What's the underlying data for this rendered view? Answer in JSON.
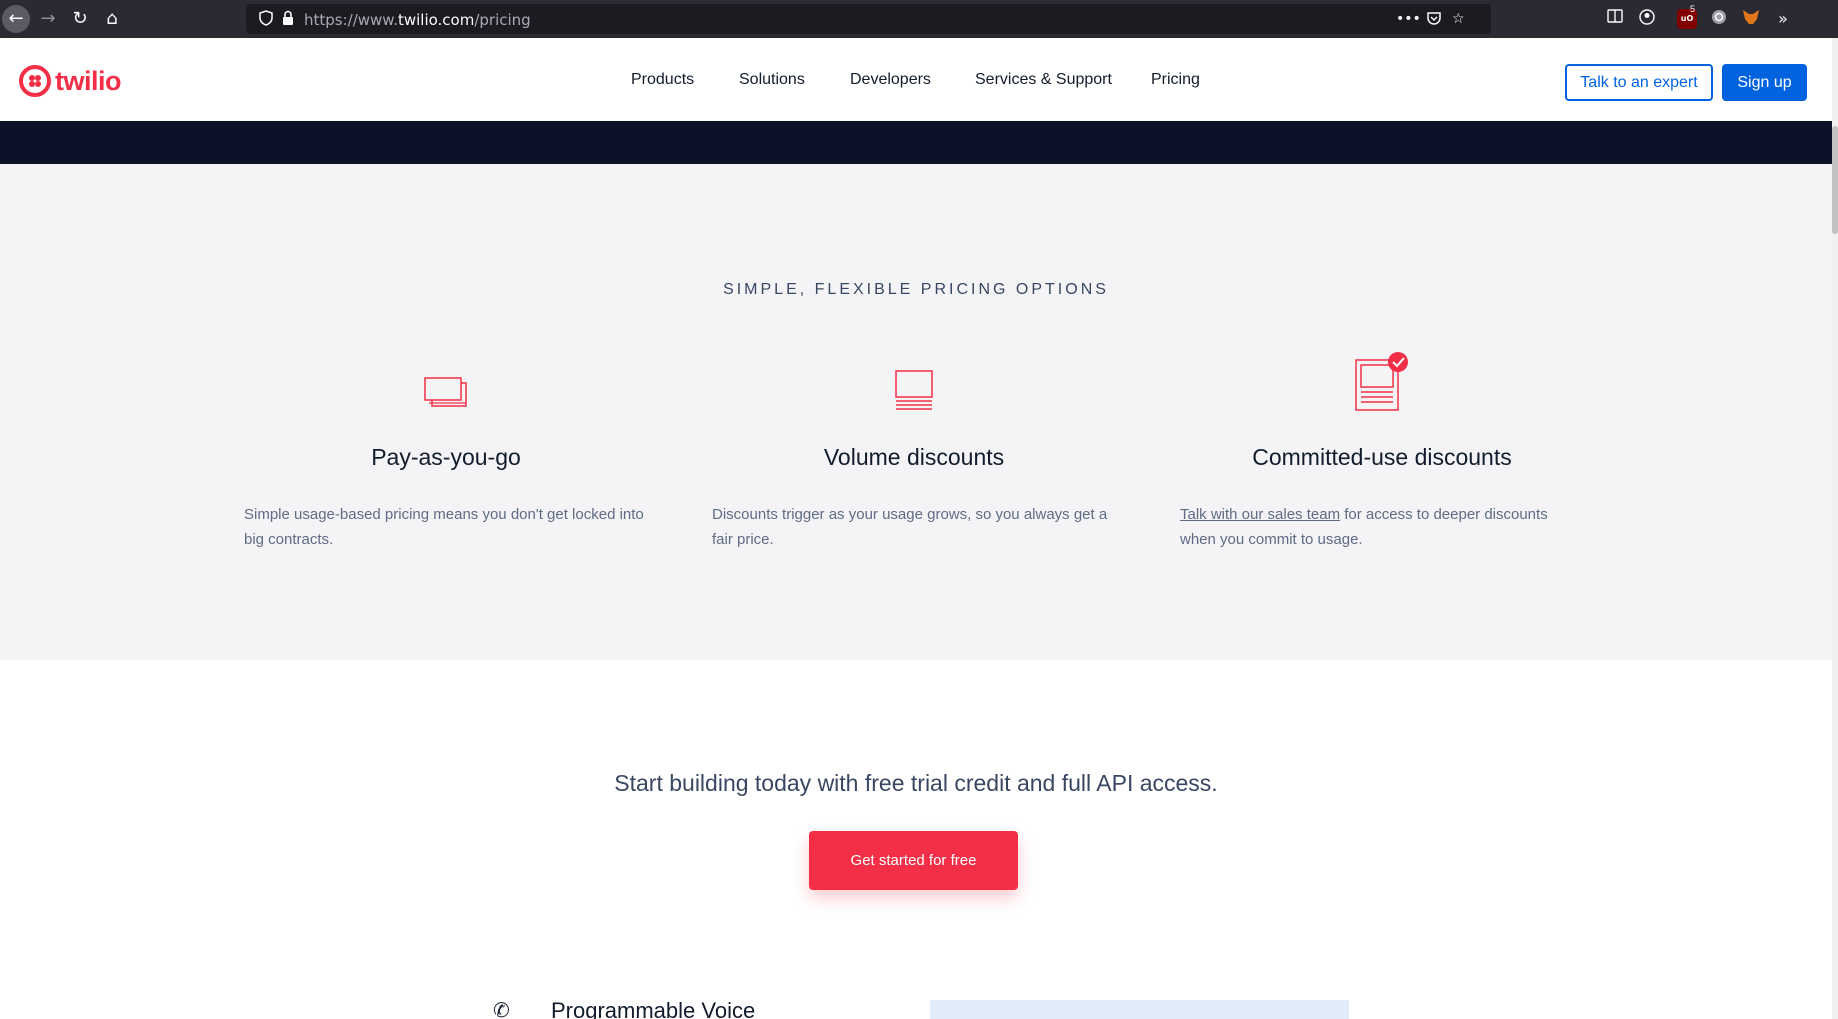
{
  "browser": {
    "url_scheme": "https://www.",
    "url_domain": "twilio.com",
    "url_path": "/pricing",
    "more_glyph": "•••",
    "ublock_count": "5"
  },
  "site": {
    "brand_color": "#f22f46",
    "logo_text": "twilio",
    "nav": [
      "Products",
      "Solutions",
      "Developers",
      "Services & Support",
      "Pricing"
    ],
    "talk_button": "Talk to an expert",
    "signup_button": "Sign up"
  },
  "options": {
    "eyebrow": "SIMPLE, FLEXIBLE PRICING OPTIONS",
    "items": [
      {
        "icon": "chat-bubbles-icon",
        "title": "Pay-as-you-go",
        "desc": "Simple usage-based pricing means you don't get locked into big contracts."
      },
      {
        "icon": "stacked-document-icon",
        "title": "Volume discounts",
        "desc": "Discounts trigger as your usage grows, so you always get a fair price."
      },
      {
        "icon": "checked-document-icon",
        "title": "Committed-use discounts",
        "desc_link": "Talk with our sales team",
        "desc_rest": " for access to deeper discounts when you commit to usage."
      }
    ]
  },
  "cta": {
    "text": "Start building today with free trial credit and full API access.",
    "button": "Get started for free"
  },
  "next_section": {
    "title": "Programmable Voice"
  }
}
